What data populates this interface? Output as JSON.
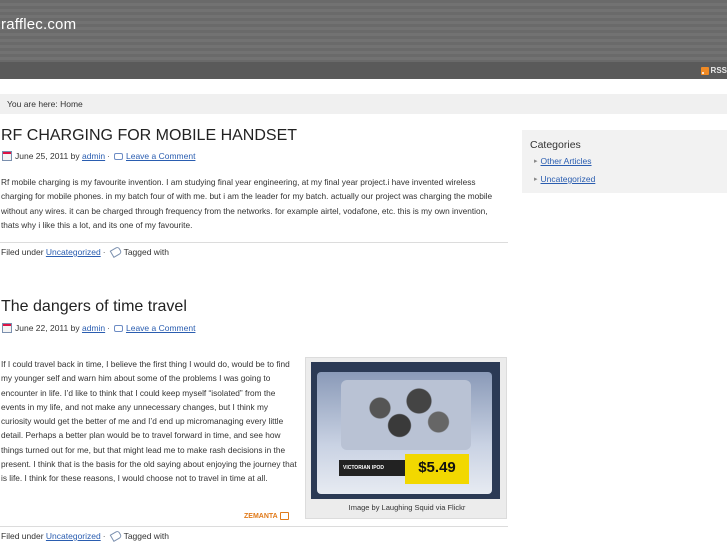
{
  "site": {
    "title": "rafflec.com",
    "rss_label": "RSS"
  },
  "breadcrumb": {
    "text": "You are here: Home"
  },
  "posts": [
    {
      "title": "RF CHARGING FOR MOBILE HANDSET",
      "date": "June 25, 2011",
      "by": "by",
      "author": "admin",
      "comment_link": "Leave a Comment",
      "body": "Rf mobile charging is my favourite invention. I am studying final year engineering, at my final year project.i have invented wireless charging for mobile phones. in my batch four of with me. but i am the leader for my batch. actually our project was charging the mobile without any wires. it can be charged through frequency from the networks. for example airtel, vodafone, etc. this is my own invention, thats why i like this a lot, and its one of my favourite.",
      "filed_under": "Filed under",
      "category": "Uncategorized",
      "tagged": "Tagged with"
    },
    {
      "title": "The dangers of time travel",
      "date": "June 22, 2011",
      "by": "by",
      "author": "admin",
      "comment_link": "Leave a Comment",
      "body": "If I could travel back in time, I believe the first thing I would do, would be to find my younger self and warn him about some of the problems I was going to encounter in life.  I’d like to think that I could keep myself “isolated” from the events in my life, and not make any unnecessary changes, but I think my curiosity would get the better of me and I’d end up micromanaging every little detail.  Perhaps a better plan would be to travel forward in time, and see how things turned out for me, but that might lead me to make rash decisions in the present.  I think that is the basis for the old saying about enjoying the journey that is life.  I think for these reasons, I would choose not to travel in time at all.",
      "image_caption": "Image by Laughing Squid via Flickr",
      "image_label": "VICTORIAN IPOD",
      "image_price": "$5.49",
      "zemanta": "ZEMANTA",
      "filed_under": "Filed under",
      "category": "Uncategorized",
      "tagged": "Tagged with"
    }
  ],
  "sidebar": {
    "title": "Categories",
    "items": [
      {
        "label": "Other Articles"
      },
      {
        "label": "Uncategorized"
      }
    ]
  },
  "colors": {
    "header": "#6a6a6a",
    "link": "#2a5db0",
    "zemanta": "#e07a1a",
    "price_tag": "#f2d800"
  }
}
